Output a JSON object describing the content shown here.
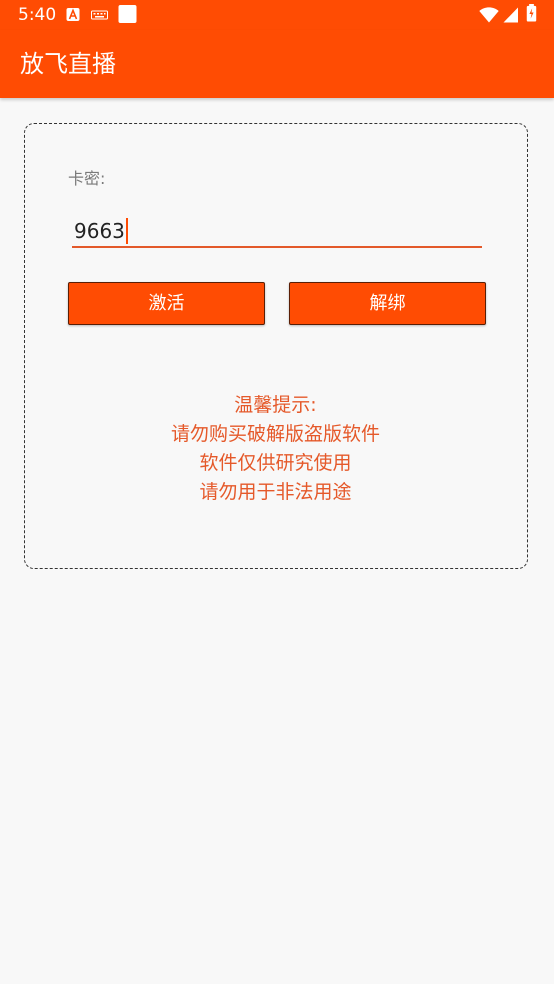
{
  "status_bar": {
    "time": "5:40",
    "icons": [
      "a-notification-icon",
      "keyboard-icon",
      "white-square-icon",
      "wifi-icon",
      "cell-signal-icon",
      "battery-icon"
    ]
  },
  "app_bar": {
    "title": "放飞直播"
  },
  "card": {
    "label": "卡密:",
    "code_value": "9663",
    "activate_label": "激活",
    "unbind_label": "解绑",
    "notice_lines": [
      "温馨提示:",
      "请勿购买破解版盗版软件",
      "软件仅供研究使用",
      "请勿用于非法用途"
    ]
  },
  "colors": {
    "accent": "#ff4c03",
    "notice_text": "#e5592a",
    "background": "#f8f8f8"
  }
}
